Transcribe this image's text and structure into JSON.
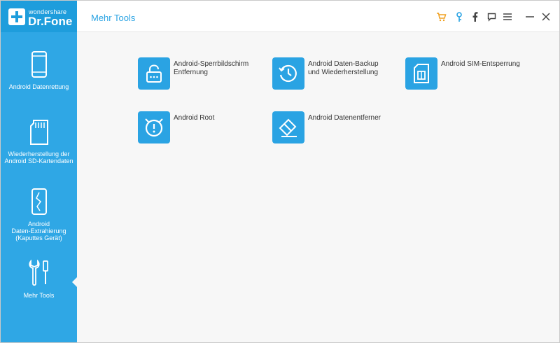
{
  "app": {
    "brand_small": "wondershare",
    "brand_big": "Dr.Fone",
    "page_title": "Mehr Tools"
  },
  "colors": {
    "sidebar": "#2fa7e5",
    "accent": "#2aa3e3",
    "cart": "#f0a020"
  },
  "sidebar": {
    "items": [
      {
        "label": "Android Datenrettung",
        "icon": "phone-icon"
      },
      {
        "label": "Wiederherstellung der\nAndroid SD-Kartendaten",
        "icon": "sd-card-icon"
      },
      {
        "label": "Android\nDaten-Extrahierung\n(Kaputtes Gerät)",
        "icon": "broken-phone-icon"
      },
      {
        "label": "Mehr Tools",
        "icon": "tools-icon"
      }
    ]
  },
  "header_icons": [
    "cart-icon",
    "key-icon",
    "facebook-icon",
    "feedback-icon",
    "menu-icon",
    "minimize-icon",
    "close-icon"
  ],
  "tools": [
    {
      "label": "Android-Sperrbildschirm\nEntfernung",
      "icon": "lock-icon"
    },
    {
      "label": "Android Daten-Backup\nund Wiederherstellung",
      "icon": "history-icon"
    },
    {
      "label": "Android SIM-Entsperrung",
      "icon": "sim-icon"
    },
    {
      "label": "Android Root",
      "icon": "root-icon"
    },
    {
      "label": "Android Datenentferner",
      "icon": "eraser-icon"
    }
  ]
}
